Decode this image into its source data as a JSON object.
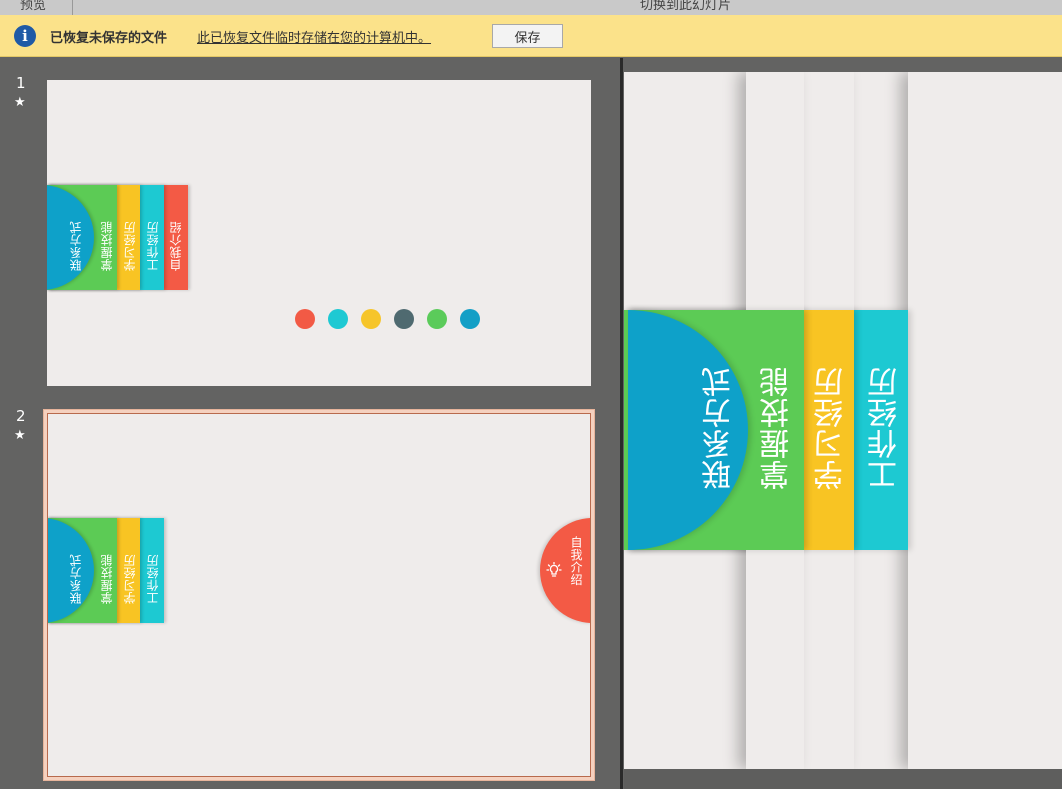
{
  "header": {
    "left_label": "预览",
    "right_label": "切换到此幻灯片"
  },
  "infobar": {
    "icon": "info-icon",
    "title": "已恢复未保存的文件",
    "message": "此已恢复文件临时存储在您的计算机中。",
    "save_label": "保存"
  },
  "slides": [
    {
      "number": "1",
      "tabs": [
        "联系方式",
        "掌握技能",
        "学习经历",
        "工作经历",
        "自我介绍"
      ],
      "dots": [
        "#f25a45",
        "#1ec9d3",
        "#f6c52a",
        "#4f6a70",
        "#5bcb5a",
        "#139fc6"
      ]
    },
    {
      "number": "2",
      "tabs": [
        "联系方式",
        "掌握技能",
        "学习经历",
        "工作经历"
      ],
      "right_tab": "自我介绍"
    }
  ],
  "preview": {
    "tabs": [
      "联系方式",
      "掌握技能",
      "学习经历",
      "工作经历"
    ]
  },
  "colors": {
    "blue": "#0ea1c9",
    "green": "#5ccb55",
    "yellow": "#f8c423",
    "cyan": "#1dc9d2",
    "red": "#f35a45",
    "infobar": "#fbe28a",
    "slide_bg": "#efeceb"
  }
}
